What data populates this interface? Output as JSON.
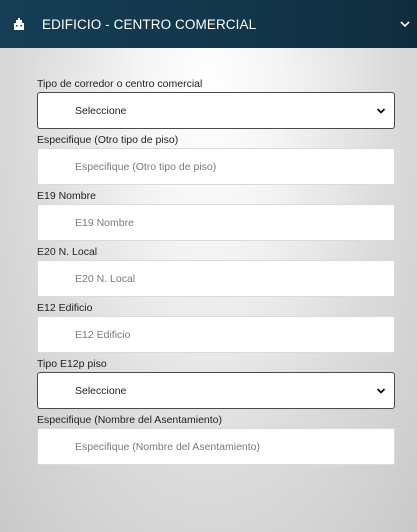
{
  "header": {
    "title": "EDIFICIO - CENTRO COMERCIAL",
    "icon": "building-icon",
    "toggle_icon": "chevron-down-icon"
  },
  "fields": [
    {
      "label": "Tipo de corredor o centro comercial",
      "type": "select",
      "value": "Seleccione"
    },
    {
      "label": "Especifique (Otro tipo de piso)",
      "type": "input",
      "placeholder": "Especifique (Otro tipo de piso)"
    },
    {
      "label": "E19 Nombre",
      "type": "input",
      "placeholder": "E19 Nombre"
    },
    {
      "label": "E20 N. Local",
      "type": "input",
      "placeholder": "E20 N. Local"
    },
    {
      "label": "E12 Edificio",
      "type": "input",
      "placeholder": "E12 Edificio"
    },
    {
      "label": "Tipo E12p piso",
      "type": "select",
      "value": "Seleccione"
    },
    {
      "label": "Especifique (Nombre del Asentamiento)",
      "type": "input",
      "placeholder": "Especifique (Nombre del Asentamiento)"
    }
  ],
  "colors": {
    "header_bg": "#163e56",
    "header_text": "#ffffff"
  }
}
